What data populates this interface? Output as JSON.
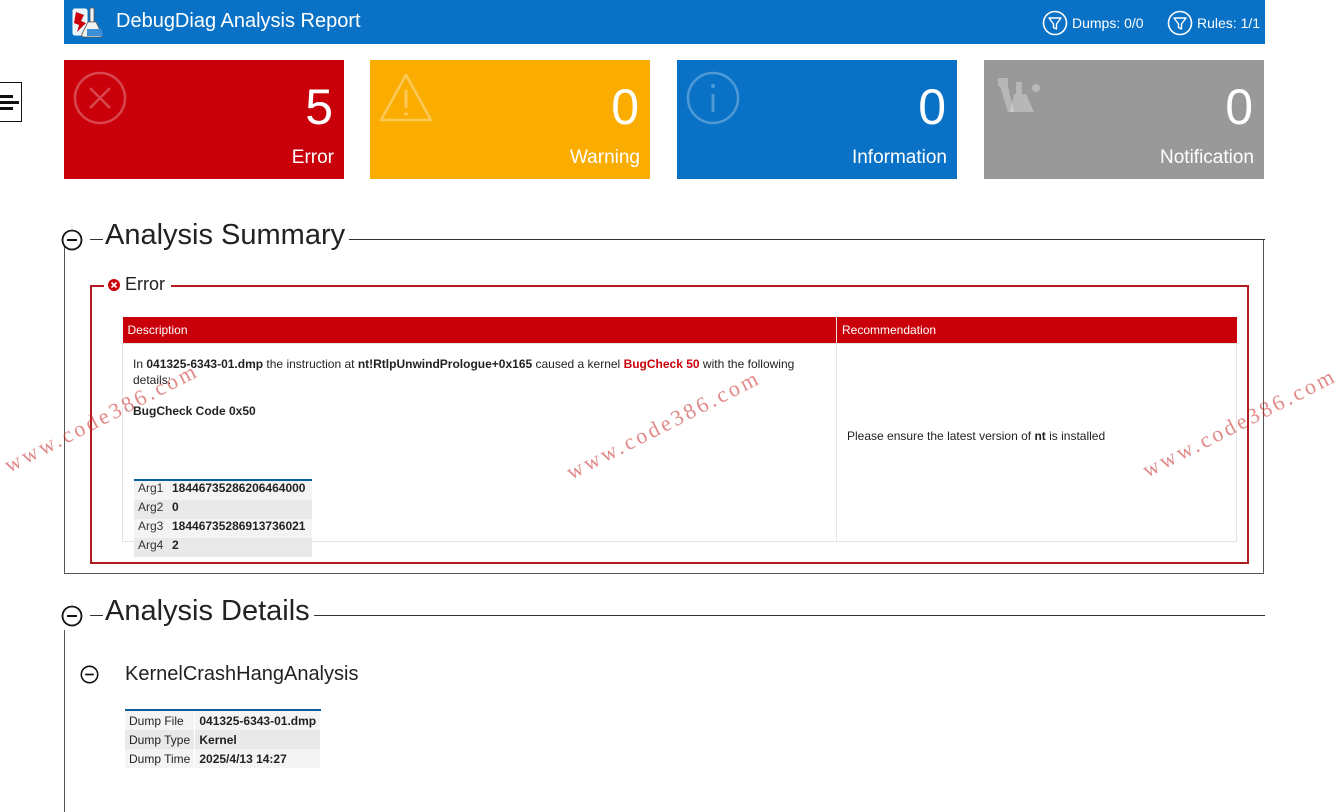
{
  "header": {
    "title": "DebugDiag Analysis Report",
    "dumps_filter": "Dumps: 0/0",
    "rules_filter": "Rules: 1/1"
  },
  "tiles": [
    {
      "count": "5",
      "label": "Error",
      "color": "#c9000a"
    },
    {
      "count": "0",
      "label": "Warning",
      "color": "#fbac00"
    },
    {
      "count": "0",
      "label": "Information",
      "color": "#0a72c6"
    },
    {
      "count": "0",
      "label": "Notification",
      "color": "#999999"
    }
  ],
  "summary": {
    "title": "Analysis Summary",
    "group_label": "Error",
    "columns": [
      "Description",
      "Recommendation"
    ],
    "description": {
      "prefix": "In ",
      "dump_file": "041325-6343-01.dmp",
      "middle": " the instruction at ",
      "instruction": "nt!RtlpUnwindPrologue+0x165",
      "middle2": " caused a kernel ",
      "bugcheck": "BugCheck 50",
      "suffix": " with the following details:",
      "bugcheck_code": "BugCheck Code 0x50",
      "args": [
        {
          "key": "Arg1",
          "value": "18446735286206464000"
        },
        {
          "key": "Arg2",
          "value": "0"
        },
        {
          "key": "Arg3",
          "value": "18446735286913736021"
        },
        {
          "key": "Arg4",
          "value": "2"
        }
      ]
    },
    "recommendation": {
      "prefix": "Please ensure the latest version of ",
      "module": "nt",
      "suffix": " is installed"
    }
  },
  "details": {
    "title": "Analysis Details",
    "subsection": "KernelCrashHangAnalysis",
    "rows": [
      {
        "key": "Dump File",
        "value": "041325-6343-01.dmp"
      },
      {
        "key": "Dump Type",
        "value": "Kernel"
      },
      {
        "key": "Dump Time",
        "value": "2025/4/13 14:27"
      }
    ]
  },
  "watermarks": [
    "www.code386.com",
    "www.code386.com",
    "www.code386.com"
  ]
}
